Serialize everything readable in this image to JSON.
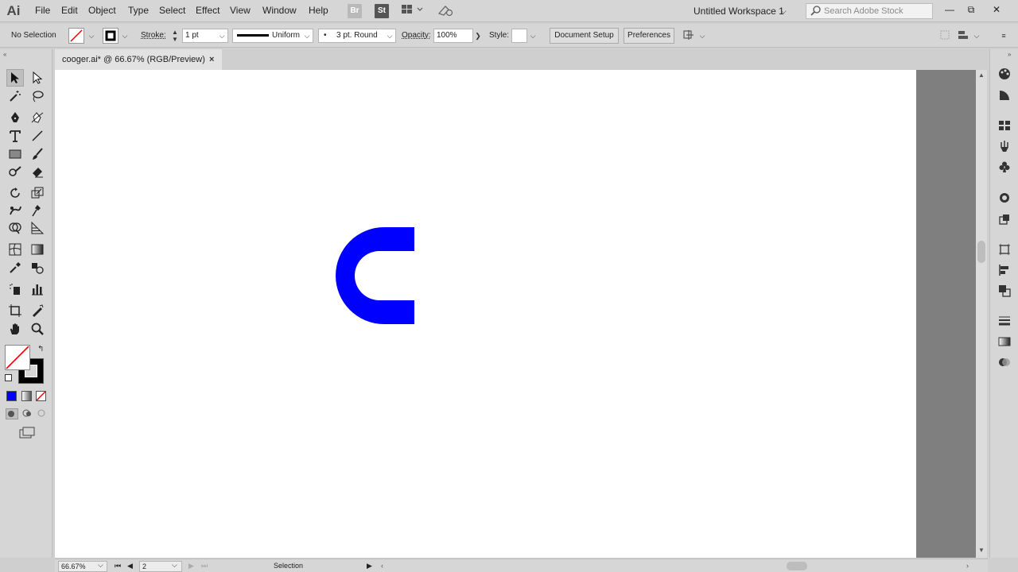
{
  "app": {
    "logo": "Ai"
  },
  "menu": [
    "File",
    "Edit",
    "Object",
    "Type",
    "Select",
    "Effect",
    "View",
    "Window",
    "Help"
  ],
  "menubar_icons": {
    "bridge": "Br",
    "stock": "St"
  },
  "workspace": {
    "label": "Untitled Workspace 1"
  },
  "search": {
    "placeholder": "Search Adobe Stock"
  },
  "window_controls": {
    "minimize": "—",
    "restore": "⧉",
    "close": "✕"
  },
  "control_bar": {
    "selection_label": "No Selection",
    "stroke_label": "Stroke:",
    "stroke_weight": "1 pt",
    "variable_width_profile": "Uniform",
    "brush_definition": "3 pt. Round",
    "opacity_label": "Opacity:",
    "opacity_value": "100%",
    "style_label": "Style:",
    "document_setup": "Document Setup",
    "preferences": "Preferences"
  },
  "document_tab": {
    "title": "cooger.ai* @ 66.67% (RGB/Preview)",
    "close": "×"
  },
  "artwork": {
    "fill_color": "#0000ff",
    "shape_name": "c-shape"
  },
  "status_bar": {
    "zoom": "66.67%",
    "artboard_number": "2",
    "current_tool": "Selection"
  },
  "colors": {
    "fill_swatch": "#ffffff",
    "stroke_swatch": "#000000",
    "color_mode": "#0000ff"
  }
}
